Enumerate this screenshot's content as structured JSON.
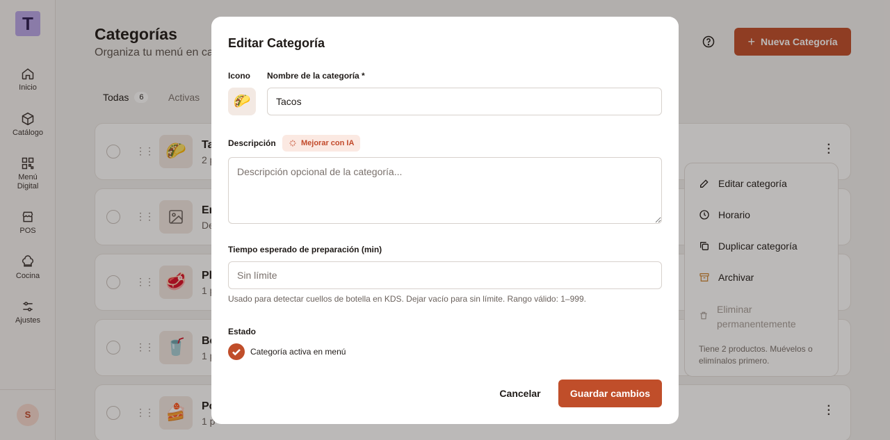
{
  "sidebar": {
    "logo_letter": "T",
    "items": [
      {
        "label": "Inicio",
        "icon": "home-icon"
      },
      {
        "label": "Catálogo",
        "icon": "box-icon"
      },
      {
        "label": "Menú Digital",
        "icon": "qr-icon"
      },
      {
        "label": "POS",
        "icon": "store-icon"
      },
      {
        "label": "Cocina",
        "icon": "chef-hat-icon"
      },
      {
        "label": "Ajustes",
        "icon": "sliders-icon"
      }
    ],
    "avatar_letter": "S"
  },
  "header": {
    "title": "Categorías",
    "subtitle": "Organiza tu menú en ca",
    "new_button_label": "Nueva Categoría"
  },
  "tabs": [
    {
      "label": "Todas",
      "count": "6"
    },
    {
      "label": "Activas",
      "count": ""
    }
  ],
  "categories": [
    {
      "name": "Ta",
      "meta": "2 p",
      "emoji": "🌮"
    },
    {
      "name": "En",
      "meta": "De",
      "emoji": "image-placeholder"
    },
    {
      "name": "Pl",
      "meta": "1 p",
      "emoji": "🥩"
    },
    {
      "name": "Be",
      "meta": "1 p",
      "emoji": "🥤"
    },
    {
      "name": "Po",
      "meta": "1 p",
      "emoji": "🍰"
    }
  ],
  "context_menu": {
    "items": [
      {
        "label": "Editar categoría",
        "icon": "pencil-icon"
      },
      {
        "label": "Horario",
        "icon": "clock-icon"
      },
      {
        "label": "Duplicar categoría",
        "icon": "copy-icon"
      },
      {
        "label": "Archivar",
        "icon": "archive-icon"
      }
    ],
    "delete_label": "Eliminar permanentemente",
    "note": "Tiene 2 productos. Muévelos o elimínalos primero."
  },
  "modal": {
    "title": "Editar Categoría",
    "icon_label": "Icono",
    "icon_emoji": "🌮",
    "name_label": "Nombre de la categoría *",
    "name_value": "Tacos",
    "description_label": "Descripción",
    "ai_button_label": "Mejorar con IA",
    "description_placeholder": "Descripción opcional de la categoría...",
    "prep_time_label": "Tiempo esperado de preparación (min)",
    "prep_time_placeholder": "Sin límite",
    "prep_time_help": "Usado para detectar cuellos de botella en KDS. Dejar vacío para sin límite. Rango válido: 1–999.",
    "status_label": "Estado",
    "active_checkbox_label": "Categoría activa en menú",
    "active": true,
    "cancel_label": "Cancelar",
    "save_label": "Guardar cambios"
  },
  "colors": {
    "accent": "#c04e2a",
    "overlay": "rgba(30,24,20,0.30)"
  }
}
